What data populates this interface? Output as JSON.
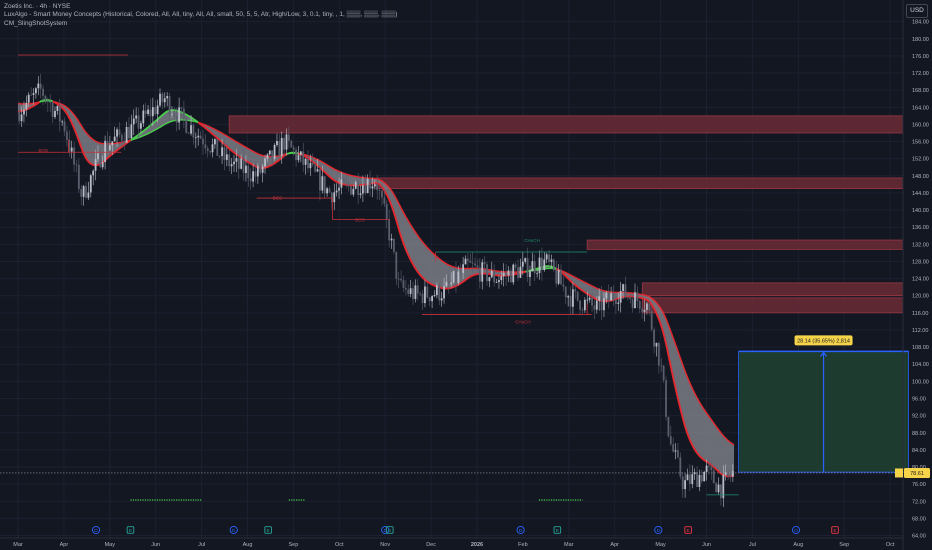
{
  "legend": {
    "symbol": "Zoetis Inc. · 4h · NYSE",
    "indicator_1": "LuxAlgo - Smart Money Concepts (Historical, Colored, All, All, tiny, All, All, small, 50, 5, 5, Atr, High/Low, 3, 0.1, tiny, , 1, ▒▒▒, ▒▒▒, ▒▒▒)",
    "indicator_2": "CM_SlingShotSystem"
  },
  "currency_button": "USD",
  "colors": {
    "background": "#131722",
    "grid": "#1c2030",
    "axis_text": "#b2b5be",
    "ema_band_fill": "#7b7d85",
    "ema_red": "#e8262d",
    "ema_green": "#4ad14c",
    "zone_fill": "#6b2c35",
    "zone_border": "#a33a47",
    "structure_red": "#c8303a",
    "structure_green": "#1f8f72",
    "projection_fill": "#1d3b2f",
    "projection_border": "#2962ff",
    "tooltip_bg": "#f5d44a",
    "price_label": "#f5d44a",
    "event_blue": "#2962ff",
    "event_red": "#f23645",
    "event_green": "#26a69a"
  },
  "chart_data": {
    "type": "candlestick",
    "title": "Zoetis Inc. · 4h · NYSE",
    "ylim": [
      62,
      188
    ],
    "y_ticks": [
      "184.00",
      "180.00",
      "176.00",
      "172.00",
      "168.00",
      "164.00",
      "160.00",
      "156.00",
      "152.00",
      "148.00",
      "144.00",
      "140.00",
      "136.00",
      "132.00",
      "128.00",
      "124.00",
      "120.00",
      "116.00",
      "112.00",
      "108.00",
      "104.00",
      "100.00",
      "96.00",
      "92.00",
      "88.00",
      "84.00",
      "80.00",
      "76.00",
      "72.00",
      "68.00",
      "64.00"
    ],
    "x_ticks": [
      "Mar",
      "Apr",
      "May",
      "Jun",
      "Jul",
      "Aug",
      "Sep",
      "Oct",
      "Nov",
      "Dec",
      "2026",
      "Feb",
      "Mar",
      "Apr",
      "May",
      "Jun",
      "Jul",
      "Aug",
      "Sep",
      "Oct"
    ],
    "price_path": [
      {
        "month": 0.0,
        "price": 163
      },
      {
        "month": 0.5,
        "price": 168
      },
      {
        "month": 1.0,
        "price": 160
      },
      {
        "month": 1.4,
        "price": 143
      },
      {
        "month": 1.9,
        "price": 155
      },
      {
        "month": 2.6,
        "price": 160
      },
      {
        "month": 3.2,
        "price": 166
      },
      {
        "month": 3.5,
        "price": 162
      },
      {
        "month": 4.0,
        "price": 157
      },
      {
        "month": 4.6,
        "price": 151
      },
      {
        "month": 5.2,
        "price": 148
      },
      {
        "month": 5.8,
        "price": 156
      },
      {
        "month": 6.3,
        "price": 150
      },
      {
        "month": 6.8,
        "price": 144
      },
      {
        "month": 7.4,
        "price": 146
      },
      {
        "month": 7.8,
        "price": 147
      },
      {
        "month": 8.1,
        "price": 134
      },
      {
        "month": 8.3,
        "price": 122
      },
      {
        "month": 8.7,
        "price": 120
      },
      {
        "month": 9.3,
        "price": 121
      },
      {
        "month": 9.8,
        "price": 127
      },
      {
        "month": 10.4,
        "price": 124
      },
      {
        "month": 10.9,
        "price": 126
      },
      {
        "month": 11.5,
        "price": 128
      },
      {
        "month": 12.0,
        "price": 120
      },
      {
        "month": 12.6,
        "price": 117
      },
      {
        "month": 13.1,
        "price": 121
      },
      {
        "month": 13.7,
        "price": 118
      },
      {
        "month": 14.0,
        "price": 104
      },
      {
        "month": 14.2,
        "price": 86
      },
      {
        "month": 14.5,
        "price": 76
      },
      {
        "month": 15.0,
        "price": 79
      },
      {
        "month": 15.3,
        "price": 75
      },
      {
        "month": 15.6,
        "price": 78.9
      }
    ],
    "current_price": "78.61",
    "current_price_label": "78.61",
    "smc_labels": [
      {
        "text": "BOS",
        "month": 0.55,
        "price": 153.5
      },
      {
        "text": "BOS",
        "month": 5.65,
        "price": 142.5
      },
      {
        "text": "BOS",
        "month": 7.45,
        "price": 137.3
      },
      {
        "text": "CHoCH",
        "month": 11.2,
        "price": 132.5
      },
      {
        "text": "CHoCH",
        "month": 11.0,
        "price": 113.5
      }
    ],
    "supply_zones": [
      {
        "from_month": 4.6,
        "to_month": 20.4,
        "top": 162,
        "bottom": 158
      },
      {
        "from_month": 7.8,
        "to_month": 20.4,
        "top": 147.5,
        "bottom": 145
      },
      {
        "from_month": 12.4,
        "to_month": 20.4,
        "top": 133,
        "bottom": 130.8
      },
      {
        "from_month": 13.6,
        "to_month": 20.4,
        "top": 123,
        "bottom": 120
      },
      {
        "from_month": 13.6,
        "to_month": 20.4,
        "top": 119.5,
        "bottom": 116
      }
    ],
    "projection": {
      "from_month": 15.7,
      "to_month": 19.4,
      "entry": 78.8,
      "target": 107,
      "label": "28.14 (35.65%) 2,814"
    },
    "events": [
      {
        "label": "D",
        "month": 1.7,
        "type": "dividend"
      },
      {
        "label": "E",
        "month": 2.45,
        "type": "earnings"
      },
      {
        "label": "D",
        "month": 4.7,
        "type": "dividend"
      },
      {
        "label": "E",
        "month": 5.45,
        "type": "earnings"
      },
      {
        "label": "D",
        "month": 8.0,
        "type": "dividend"
      },
      {
        "label": "E",
        "month": 8.1,
        "type": "earnings"
      },
      {
        "label": "D",
        "month": 10.95,
        "type": "dividend"
      },
      {
        "label": "E",
        "month": 11.75,
        "type": "earnings"
      },
      {
        "label": "D",
        "month": 13.95,
        "type": "dividend"
      },
      {
        "label": "E",
        "month": 14.6,
        "type": "earnings_upcoming"
      },
      {
        "label": "D",
        "month": 16.95,
        "type": "dividend"
      },
      {
        "label": "E",
        "month": 17.8,
        "type": "earnings_upcoming"
      }
    ]
  }
}
